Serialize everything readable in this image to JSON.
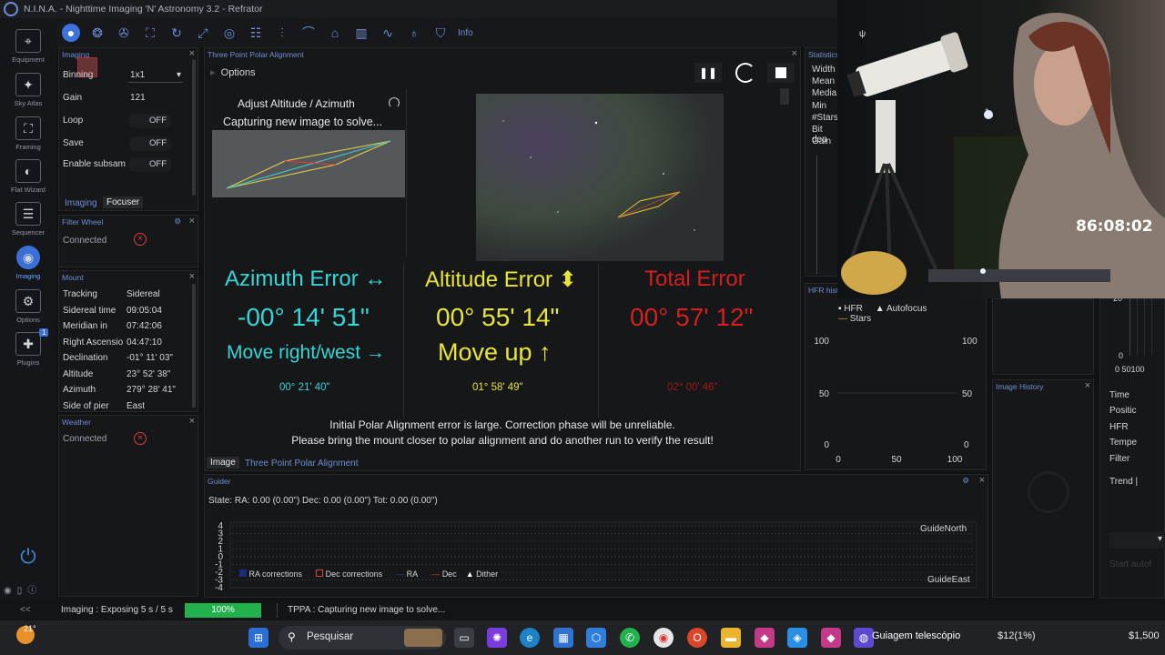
{
  "window": {
    "title": "N.I.N.A. - Nighttime Imaging 'N' Astronomy 3.2  -  Refrator"
  },
  "nav": [
    {
      "label": "Equipment",
      "icon": "equipment-icon",
      "glyph": "⌖"
    },
    {
      "label": "Sky Atlas",
      "icon": "sky-atlas-icon",
      "glyph": "✦"
    },
    {
      "label": "Framing",
      "icon": "framing-icon",
      "glyph": "⛶"
    },
    {
      "label": "Flat Wizard",
      "icon": "flat-wizard-icon",
      "glyph": "◐"
    },
    {
      "label": "Sequencer",
      "icon": "sequencer-icon",
      "glyph": "☰"
    },
    {
      "label": "Imaging",
      "icon": "imaging-icon",
      "glyph": "◉"
    },
    {
      "label": "Options",
      "icon": "options-icon",
      "glyph": "⚙"
    },
    {
      "label": "Plugins",
      "icon": "plugins-icon",
      "glyph": "✚",
      "badge": "1"
    }
  ],
  "toolbar": {
    "info_label": "Info"
  },
  "imaging_panel": {
    "title": "Imaging",
    "rows": [
      {
        "label": "Binning",
        "value": "1x1"
      },
      {
        "label": "Gain",
        "value": "121"
      },
      {
        "label": "Loop",
        "value": "OFF"
      },
      {
        "label": "Save",
        "value": "OFF"
      },
      {
        "label": "Enable subsam",
        "value": "OFF"
      }
    ],
    "tabs": [
      "Imaging",
      "Focuser"
    ]
  },
  "filter_wheel": {
    "title": "Filter Wheel",
    "status": "Connected"
  },
  "mount": {
    "title": "Mount",
    "rows": [
      {
        "label": "Tracking",
        "value": "Sidereal"
      },
      {
        "label": "Sidereal time",
        "value": "09:05:04"
      },
      {
        "label": "Meridian in",
        "value": "07:42:06"
      },
      {
        "label": "Right Ascensio",
        "value": "04:47:10"
      },
      {
        "label": "Declination",
        "value": "-01° 11' 03\""
      },
      {
        "label": "Altitude",
        "value": "23° 52' 38\""
      },
      {
        "label": "Azimuth",
        "value": "279° 28' 41\""
      },
      {
        "label": "Side of pier",
        "value": "East"
      }
    ]
  },
  "weather": {
    "title": "Weather",
    "status": "Connected"
  },
  "tppa": {
    "title": "Three Point Polar Alignment",
    "options_label": "Options",
    "step_title": "Adjust Altitude / Azimuth",
    "step_status": "Capturing new image to solve...",
    "azimuth": {
      "heading": "Azimuth Error ↔",
      "error": "-00° 14' 51\"",
      "move": "Move right/west →",
      "sub": "00° 21' 40\""
    },
    "altitude": {
      "heading": "Altitude Error ⬍",
      "error": "00° 55' 14\"",
      "move": "Move up ↑",
      "sub": "01° 58' 49\""
    },
    "total": {
      "heading": "Total Error",
      "error": "00° 57' 12\"",
      "sub": "02° 00' 46\""
    },
    "warning_1": "Initial Polar Alignment error is large. Correction phase will be unreliable.",
    "warning_2": "Please bring the mount closer to polar alignment and do another run to verify the result!",
    "tabs": [
      "Image",
      "Three Point Polar Alignment"
    ]
  },
  "statistics": {
    "title": "Statistics",
    "rows": [
      "Width",
      "Mean",
      "Media",
      "Min",
      "#Stars",
      "Bit dep",
      "Gain"
    ]
  },
  "hfr_history": {
    "title": "HFR histo",
    "legend": [
      "HFR",
      "Autofocus",
      "Stars"
    ],
    "y_ticks": [
      "100",
      "50",
      "0"
    ],
    "x_ticks": [
      "0",
      "50",
      "100"
    ]
  },
  "image_history": {
    "title": "Image History"
  },
  "right_panel": {
    "rows": [
      "Time",
      "Positic",
      "HFR",
      "Tempe",
      "Filter",
      "Trend  |"
    ],
    "y_ticks": [
      "20",
      "0"
    ],
    "x_ticks": "0 50100",
    "button": "Start autof"
  },
  "guider": {
    "title": "Guider",
    "state": "State:  RA: 0.00 (0.00\")  Dec: 0.00 (0.00\")  Tot: 0.00 (0.00\")",
    "y_ticks": [
      "4",
      "3",
      "2",
      "1",
      "0",
      "-1",
      "-2",
      "-3",
      "-4"
    ],
    "north": "GuideNorth",
    "east": "GuideEast",
    "legend": [
      "RA corrections",
      "Dec corrections",
      "RA",
      "Dec",
      "Dither"
    ]
  },
  "statusbar": {
    "collapse": "<<",
    "imaging": "Imaging :   Exposing 5 s / 5 s",
    "progress_percent": 100,
    "progress_label": "100%",
    "tppa": "TPPA :   Capturing new image to solve..."
  },
  "overlay": {
    "timer": "86:08:02",
    "cam_label": "ψ"
  },
  "taskbar": {
    "weather": "21°",
    "search": "Pesquisar",
    "active_app": "Guiagem telescópio",
    "ticker_1": "$12(1%)",
    "ticker_2": "$1,500"
  },
  "colors": {
    "azimuth": "#35d6d6",
    "altitude": "#e8e43a",
    "total": "#d41f1f",
    "accent": "#3b6fd6"
  }
}
